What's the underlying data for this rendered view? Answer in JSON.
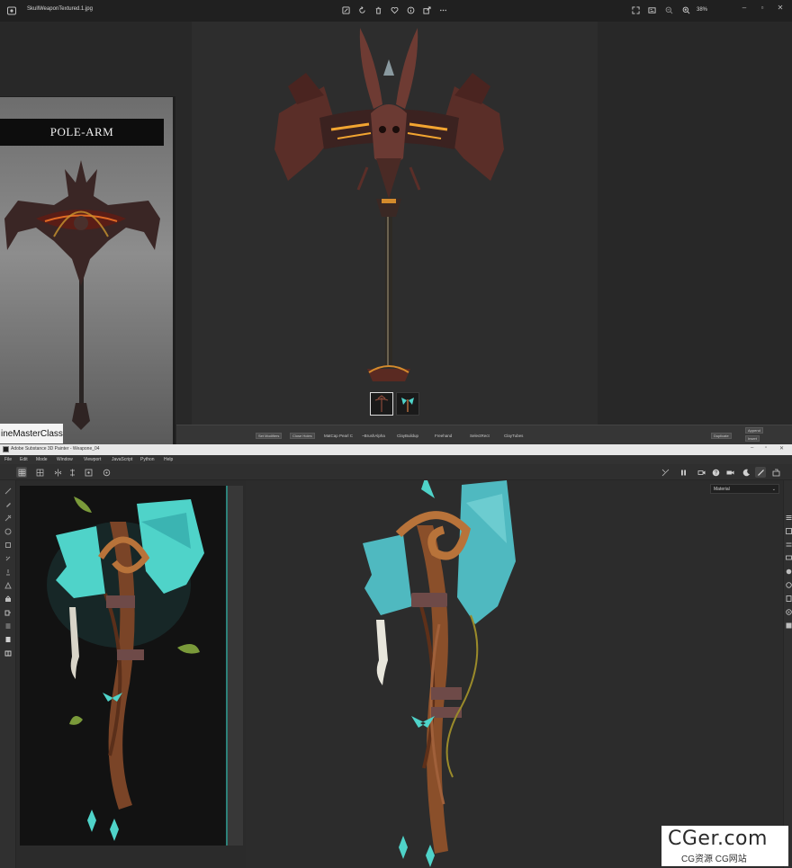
{
  "photos": {
    "filename": "SkullWeaponTextured.1.jpg",
    "zoom": "38%",
    "toolbar": [
      {
        "name": "edit-image-icon"
      },
      {
        "name": "rotate-icon"
      },
      {
        "name": "delete-icon"
      },
      {
        "name": "favorite-icon"
      },
      {
        "name": "info-icon"
      },
      {
        "name": "share-icon"
      },
      {
        "name": "more-icon"
      }
    ],
    "reference": {
      "title": "POLE-ARM",
      "brand": "ineMasterClass"
    },
    "zbrush_strip": {
      "items": [
        "Set Modifiers",
        "Close Holes",
        "MatCap Pearl C",
        "~BrushAlpha",
        "ClayBuildup",
        "Freehand",
        "SelectRect",
        "ClayTubes"
      ],
      "buttons": [
        "Duplicate",
        "Append",
        "Insert"
      ]
    },
    "colors": {
      "accent_orange": "#d48a2c",
      "ember": "#f2a531"
    }
  },
  "painter": {
    "title": "Adobe Substance 3D Painter - Weapone_04",
    "menus": [
      "File",
      "Edit",
      "Mode",
      "Window",
      "Viewport",
      "JavaScript",
      "Python",
      "Help"
    ],
    "material_dropdown": "Material",
    "colors": {
      "teal": "#4fd3c9",
      "wood": "#8a4f2a"
    }
  },
  "watermark": {
    "main": "CGer.com",
    "sub": "CG资源 CG网站"
  }
}
